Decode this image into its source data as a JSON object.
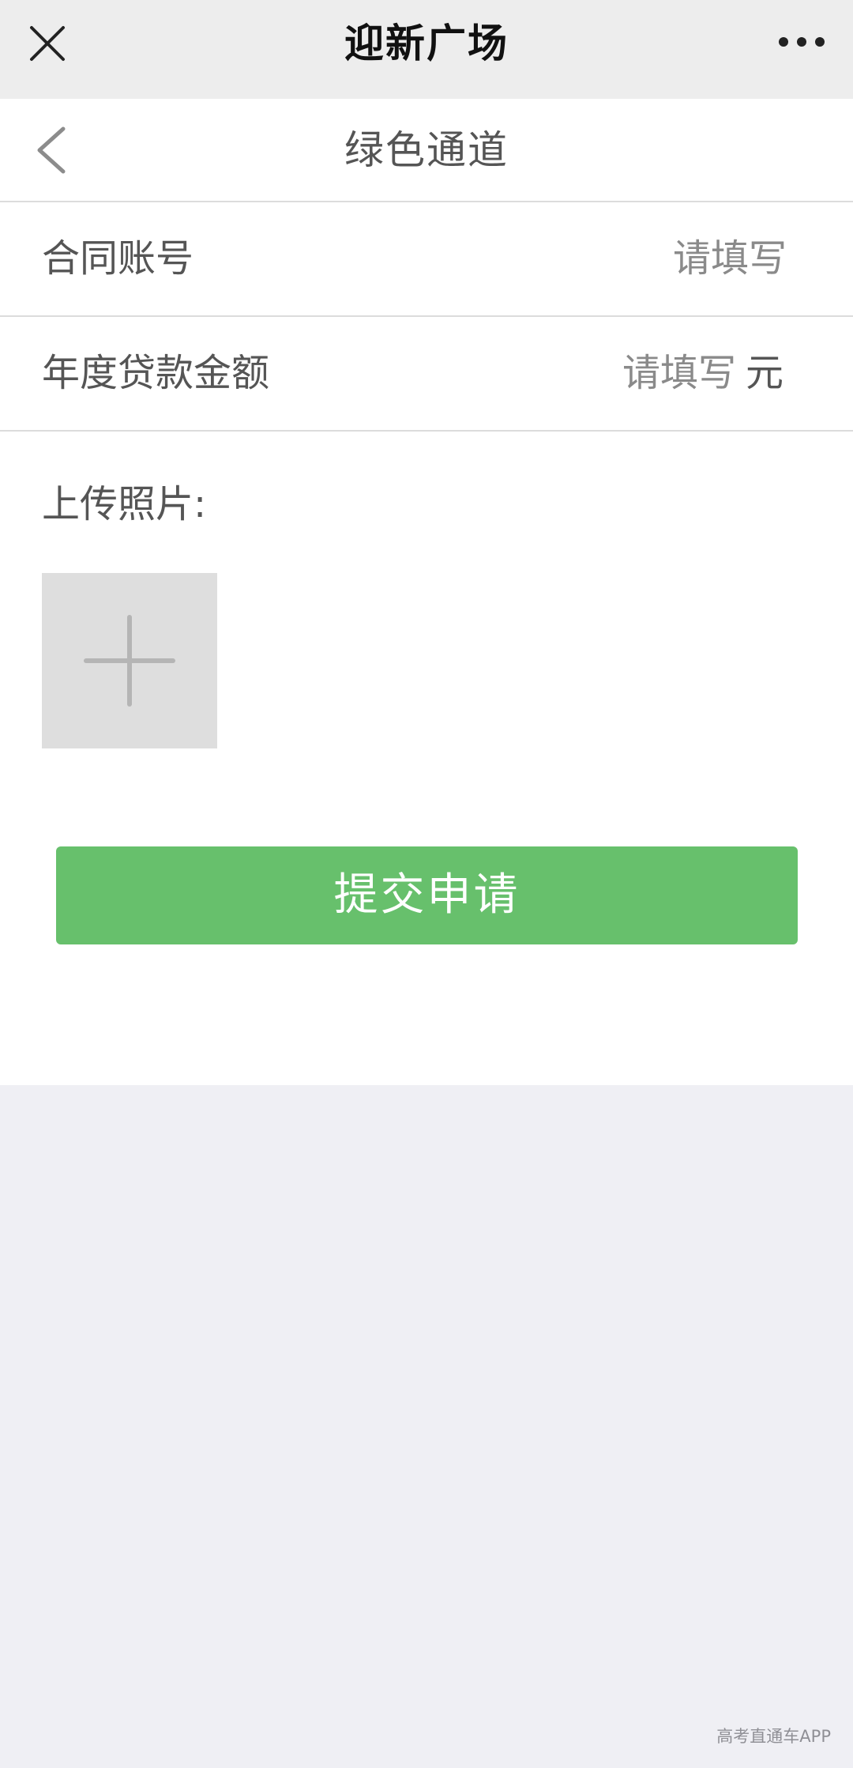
{
  "header": {
    "app_title": "迎新广场",
    "close_icon": "close-icon",
    "more_icon": "more-dots-icon"
  },
  "nav": {
    "title": "绿色通道",
    "back_icon": "chevron-left-icon"
  },
  "form": {
    "contract": {
      "label": "合同账号",
      "placeholder": "请填写",
      "value": ""
    },
    "loan": {
      "label": "年度贷款金额",
      "placeholder": "请填写",
      "value": "",
      "unit": "元"
    },
    "upload": {
      "label": "上传照片:",
      "add_icon": "plus-icon"
    },
    "submit_label": "提交申请"
  },
  "watermark": "高考直通车APP",
  "colors": {
    "accent_green": "#67c06c",
    "header_bg": "#ededed",
    "page_bg": "#efeff4",
    "upload_tile_bg": "#dedede"
  }
}
